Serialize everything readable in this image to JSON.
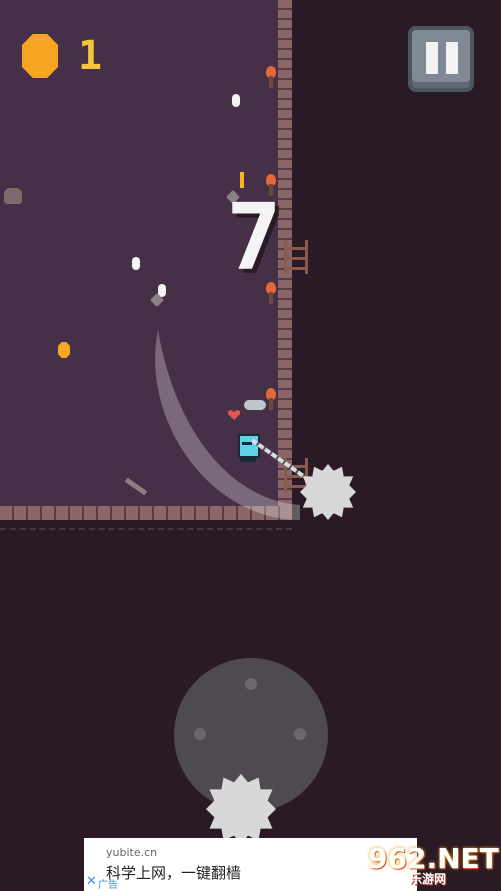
{
  "hud": {
    "coin_count": "1",
    "score": "7"
  },
  "controls": {
    "pause_icon": "pause-icon",
    "joystick_icon": "joystick-icon"
  },
  "ad": {
    "domain": "yubite.cn",
    "text": "科学上网，一键翻樯",
    "close_symbol": "✕",
    "label": "广告"
  },
  "watermark": {
    "main": "962.NET",
    "sub": "乐游网"
  },
  "colors": {
    "coin": "#f6a623",
    "room_floor": "#463048",
    "background": "#2a1a26",
    "knight": "#5fd4e6"
  }
}
